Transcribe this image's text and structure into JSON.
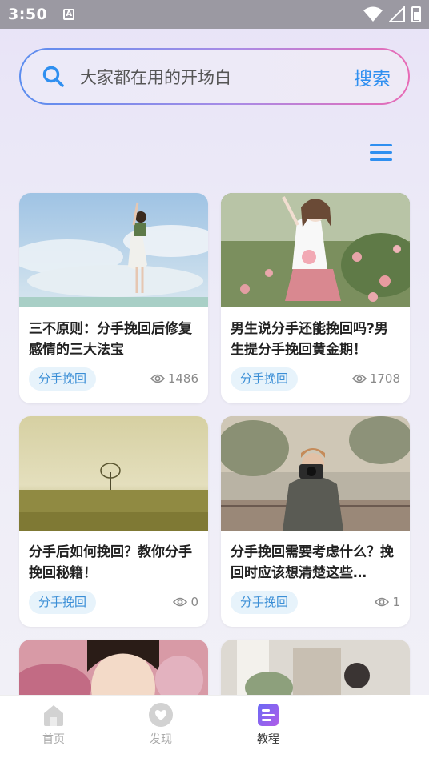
{
  "status_bar": {
    "time": "3:50",
    "notification_icon": "A"
  },
  "search": {
    "placeholder": "大家都在用的开场白",
    "button_label": "搜索"
  },
  "cards": [
    {
      "title": "三不原则：分手挽回后修复感情的三大法宝",
      "tag": "分手挽回",
      "views": "1486",
      "image": "girl-in-white-skirt-sky"
    },
    {
      "title": "男生说分手还能挽回吗?男生提分手挽回黄金期！",
      "tag": "分手挽回",
      "views": "1708",
      "image": "girl-with-flowers-garden"
    },
    {
      "title": "分手后如何挽回？教你分手挽回秘籍！",
      "tag": "分手挽回",
      "views": "0",
      "image": "lone-tree-field"
    },
    {
      "title": "分手挽回需要考虑什么？挽回时应该想清楚这些…",
      "tag": "分手挽回",
      "views": "1",
      "image": "man-with-camera"
    }
  ],
  "bottom_nav": {
    "items": [
      {
        "label": "首页",
        "icon": "home-icon",
        "active": false
      },
      {
        "label": "发现",
        "icon": "discover-heart-icon",
        "active": false
      },
      {
        "label": "教程",
        "icon": "tutorial-doc-icon",
        "active": true
      }
    ]
  },
  "colors": {
    "accent": "#2f8ff0",
    "tag_bg": "#e7f3fb",
    "tag_text": "#3a8ed6",
    "active_nav": "#7b5cf0"
  }
}
